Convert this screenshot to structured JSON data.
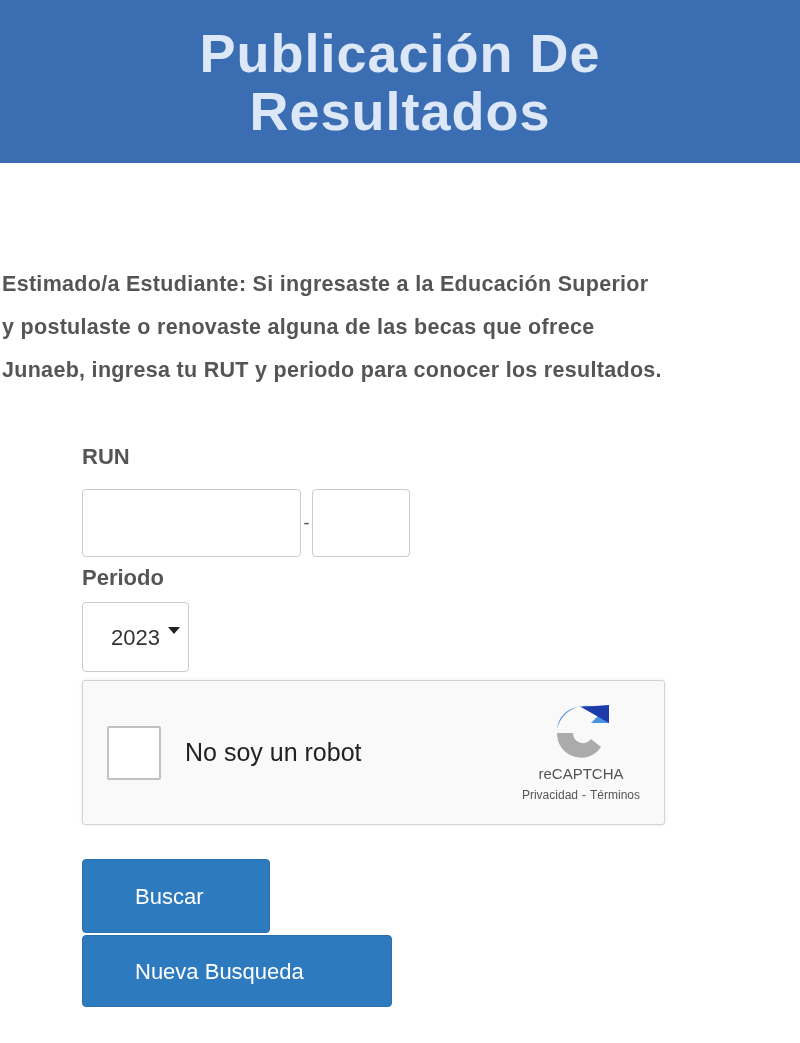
{
  "header": {
    "title_lines": [
      "Publicación De",
      "Resultados"
    ]
  },
  "intro": {
    "lines": [
      "Estimado/a Estudiante: Si ingresaste a la Educación Superior",
      "y postulaste o renovaste alguna de las becas que ofrece",
      "Junaeb, ingresa tu RUT y periodo para conocer los resultados."
    ]
  },
  "form": {
    "run_label": "RUN",
    "run_separator": "-",
    "period_label": "Periodo",
    "period_value": "2023"
  },
  "captcha": {
    "label": "No soy un robot",
    "checked": false,
    "brand": "reCAPTCHA",
    "privacy": "Privacidad",
    "separator": "-",
    "terms": "Términos"
  },
  "buttons": [
    {
      "label": "Buscar"
    },
    {
      "label": "Nueva Busqueda"
    }
  ]
}
